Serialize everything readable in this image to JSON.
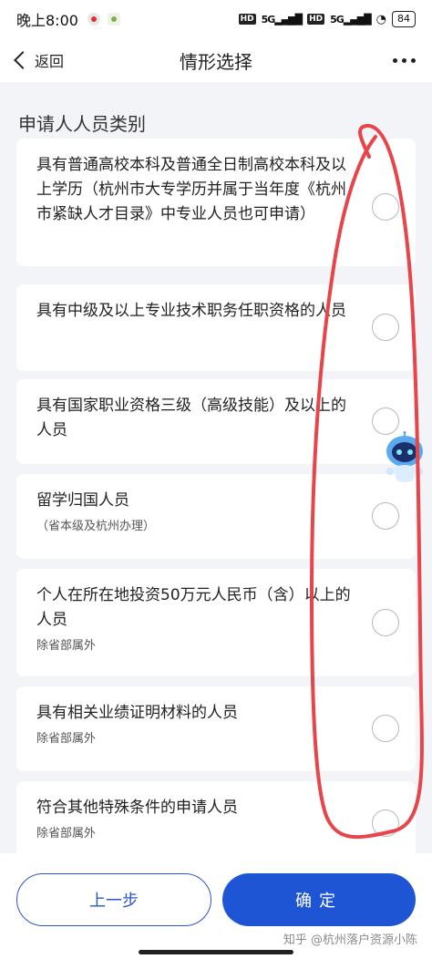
{
  "status_bar": {
    "time": "晚上8:00",
    "hd1": "HD",
    "net1": "5G",
    "hd2": "HD",
    "net2": "5G",
    "battery": "84"
  },
  "navbar": {
    "back_label": "返回",
    "title": "情形选择"
  },
  "section": {
    "title": "申请人人员类别"
  },
  "options": [
    {
      "main": "具有普通高校本科及普通全日制高校本科及以上学历（杭州市大专学历并属于当年度《杭州市紧缺人才目录》中专业人员也可申请）",
      "sub": ""
    },
    {
      "main": "具有中级及以上专业技术职务任职资格的人员",
      "sub": ""
    },
    {
      "main": "具有国家职业资格三级（高级技能）及以上的人员",
      "sub": ""
    },
    {
      "main": "留学归国人员",
      "sub": "（省本级及杭州办理）"
    },
    {
      "main": "个人在所在地投资50万元人民币（含）以上的人员",
      "sub": "除省部属外"
    },
    {
      "main": "具有相关业绩证明材料的人员",
      "sub": "除省部属外"
    },
    {
      "main": "符合其他特殊条件的申请人员",
      "sub": "除省部属外"
    }
  ],
  "footer": {
    "prev_label": "上一步",
    "confirm_label": "确定",
    "watermark": "知乎 @杭州落户资源小陈"
  },
  "colors": {
    "primary": "#1e55d4",
    "annotation": "#e8454a"
  }
}
